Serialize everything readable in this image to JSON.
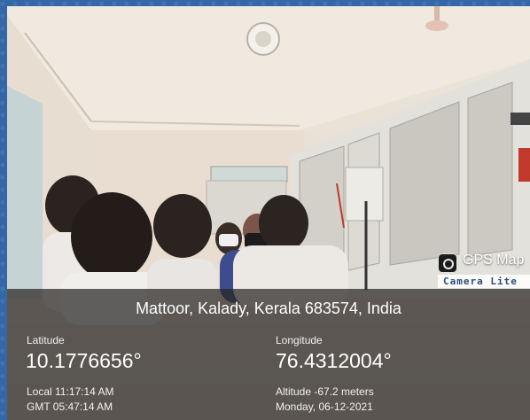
{
  "badge": {
    "app_name": "GPS Map",
    "app_sub": "Camera Lite",
    "logo_icon": "camera-lens-icon"
  },
  "location": {
    "address": "Mattoor, Kalady, Kerala 683574, India",
    "latitude_label": "Latitude",
    "latitude_value": "10.1776656°",
    "longitude_label": "Longitude",
    "longitude_value": "76.4312004°",
    "local_time": "Local 11:17:14 AM",
    "gmt_time": "GMT 05:47:14 AM",
    "altitude": "Altitude -67.2 meters",
    "date": "Monday, 06-12-2021"
  },
  "colors": {
    "border_blue": "#3467a8",
    "overlay": "rgba(40,38,36,0.72)",
    "panel_white": "#e4e2dc"
  }
}
